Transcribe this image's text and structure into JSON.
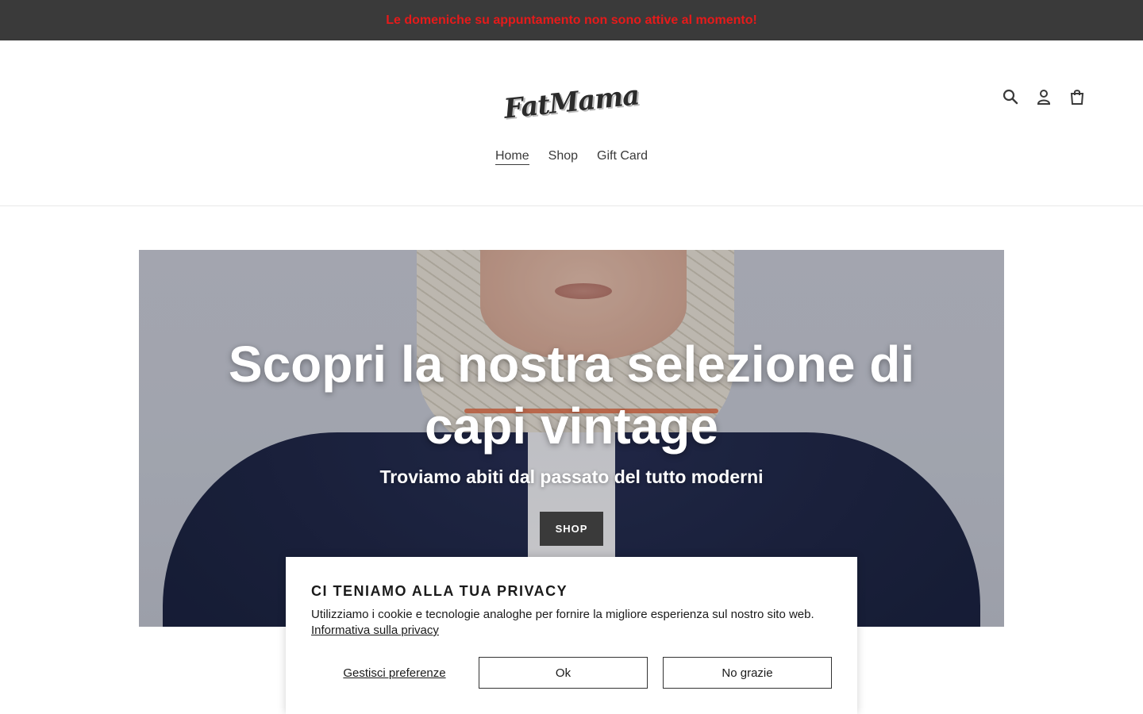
{
  "announcement": {
    "text": "Le domeniche su appuntamento non sono attive al momento!"
  },
  "header": {
    "logo_text": "FatMama",
    "icons": [
      "search-icon",
      "account-icon",
      "cart-icon"
    ],
    "nav": [
      {
        "label": "Home",
        "active": true
      },
      {
        "label": "Shop",
        "active": false
      },
      {
        "label": "Gift Card",
        "active": false
      }
    ]
  },
  "hero": {
    "title": "Scopri la nostra selezione di capi vintage",
    "subtitle": "Troviamo abiti dal passato del tutto moderni",
    "button_label": "SHOP"
  },
  "privacy": {
    "title": "CI TENIAMO ALLA TUA PRIVACY",
    "text": "Utilizziamo i cookie e tecnologie analoghe per fornire la migliore esperienza sul nostro sito web.",
    "link_label": "Informativa sulla privacy",
    "manage_label": "Gestisci preferenze",
    "ok_label": "Ok",
    "no_label": "No grazie"
  },
  "colors": {
    "announcement_bg": "#3a3a3a",
    "announcement_text": "#e61a1a",
    "button_bg": "#3a3a3a"
  }
}
